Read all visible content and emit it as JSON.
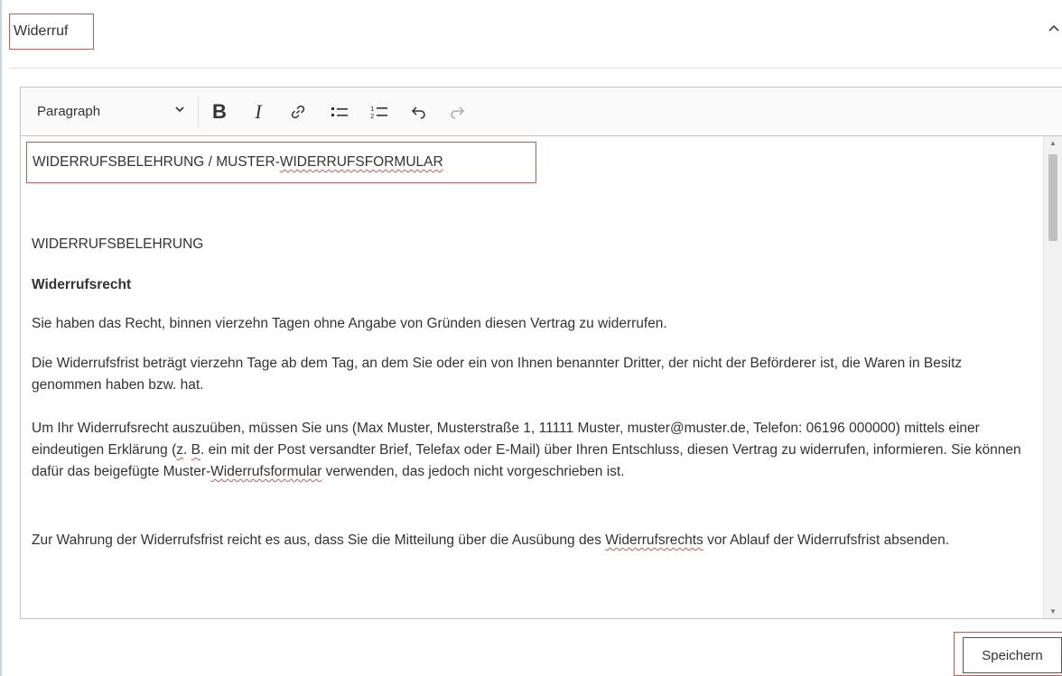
{
  "section": {
    "title": "Widerruf",
    "toggle_icon": "chevron-up-icon"
  },
  "toolbar": {
    "format_select": "Paragraph",
    "bold": "B",
    "italic": "I",
    "icons": [
      "link-icon",
      "bulleted-list-icon",
      "numbered-list-icon",
      "undo-icon",
      "redo-icon"
    ]
  },
  "content": {
    "heading_part1": "WIDERRUFSBELEHRUNG / MUSTER-",
    "heading_part2": "WIDERRUFSFORMULAR",
    "subheading": "WIDERRUFSBELEHRUNG",
    "right_title": "Widerrufsrecht",
    "p1": "Sie haben das Recht, binnen vierzehn Tagen ohne Angabe von Gründen diesen Vertrag zu widerrufen.",
    "p2": "Die Widerrufsfrist beträgt vierzehn Tage ab dem Tag, an dem Sie oder ein von Ihnen benannter Dritter, der nicht der Beförderer ist, die Waren in Besitz genommen haben bzw. hat.",
    "p3_part1": "Um Ihr Widerrufsrecht auszuüben, müssen Sie uns (Max Muster, Musterstraße 1, 11111 Muster, muster@muster.de, Telefon: 06196 000000) mittels einer eindeutigen Erklärung (",
    "p3_z": "z",
    "p3_part2": ". ",
    "p3_b": "B",
    "p3_part3": ". ein mit der Post versandter Brief, Telefax oder E-Mail) über Ihren Entschluss, diesen Vertrag zu widerrufen, informieren. Sie können dafür das beigefügte Muster-",
    "p3_word": "Widerrufsformular",
    "p3_part4": " verwenden, das jedoch nicht vorgeschrieben ist.",
    "p4_part1": "Zur Wahrung der Widerrufsfrist reicht es aus, dass Sie die Mitteilung über die Ausübung des ",
    "p4_word": "Widerrufsrechts",
    "p4_part2": " vor Ablauf der Widerrufsfrist absenden."
  },
  "save_button": {
    "label": "Speichern"
  },
  "colors": {
    "highlight": "#d9534f",
    "border": "#c4c4c4",
    "toolbar_bg": "#fafafa"
  }
}
